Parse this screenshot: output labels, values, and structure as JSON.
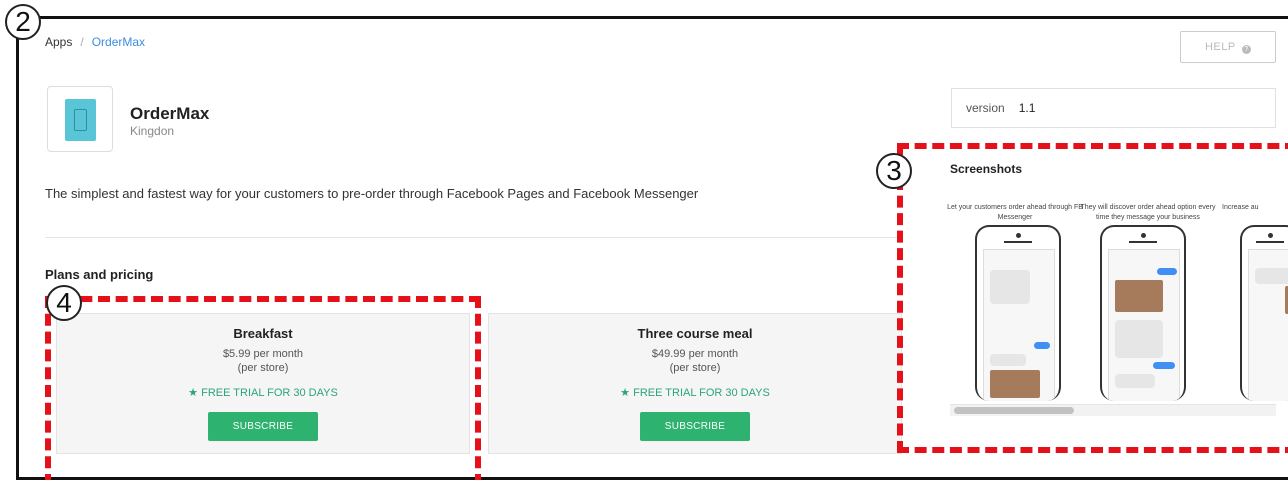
{
  "breadcrumb": {
    "root": "Apps",
    "separator": "/",
    "current": "OrderMax"
  },
  "help": {
    "label": "HELP",
    "icon": "help-circle-icon"
  },
  "app": {
    "name": "OrderMax",
    "developer": "Kingdon",
    "icon": "app-phone-icon",
    "icon_color": "#5bc5d8"
  },
  "description": "The simplest and fastest way for your customers to pre-order through Facebook Pages and Facebook Messenger",
  "plans": {
    "title": "Plans and pricing",
    "items": [
      {
        "name": "Breakfast",
        "price": "$5.99 per month",
        "unit": "(per store)",
        "trial": "FREE TRIAL FOR 30 DAYS",
        "button": "SUBSCRIBE"
      },
      {
        "name": "Three course meal",
        "price": "$49.99 per month",
        "unit": "(per store)",
        "trial": "FREE TRIAL FOR 30 DAYS",
        "button": "SUBSCRIBE"
      }
    ]
  },
  "version": {
    "label": "version",
    "value": "1.1"
  },
  "screenshots": {
    "title": "Screenshots",
    "captions": [
      "Let your customers order ahead through FB Messenger",
      "They will discover order ahead option every time they message your business",
      "Increase au"
    ]
  },
  "annotations": {
    "a2": "2",
    "a3": "3",
    "a4": "4"
  },
  "colors": {
    "accent_link": "#3a8dde",
    "subscribe": "#2eb26f",
    "trial": "#2aa57a",
    "annotation": "#e4111b"
  }
}
